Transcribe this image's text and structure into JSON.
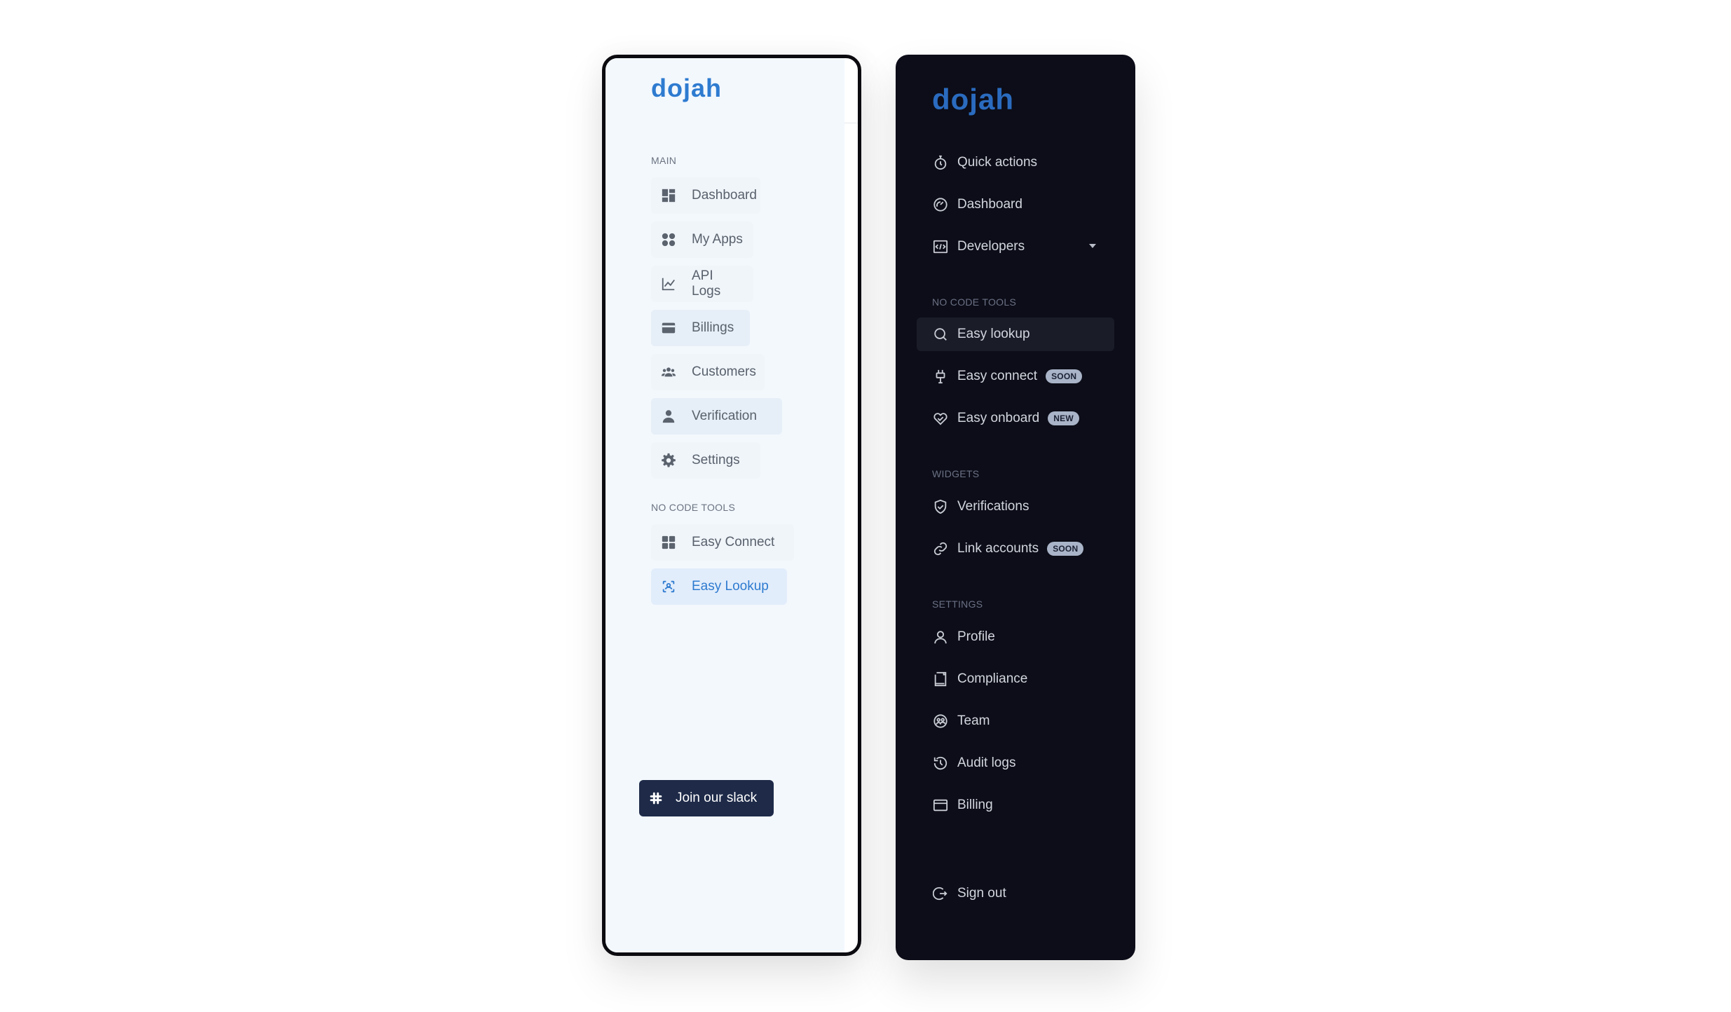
{
  "light": {
    "logo": "dojah",
    "sections": {
      "main": "MAIN",
      "no_code": "NO CODE  TOOLS"
    },
    "items": [
      {
        "label": "Dashboard",
        "icon": "dashboard-icon"
      },
      {
        "label": "My Apps",
        "icon": "apps-icon"
      },
      {
        "label": "API Logs",
        "icon": "chart-icon"
      },
      {
        "label": "Billings",
        "icon": "card-icon"
      },
      {
        "label": "Customers",
        "icon": "users-icon"
      },
      {
        "label": "Verification",
        "icon": "person-icon"
      },
      {
        "label": "Settings",
        "icon": "gear-icon"
      },
      {
        "label": "Easy Connect",
        "icon": "grid-icon"
      },
      {
        "label": "Easy Lookup",
        "icon": "lookup-icon"
      }
    ],
    "slack_label": "Join our slack",
    "accent": "#2e7bd0",
    "sidebar_bg": "#f3f8fd"
  },
  "dark": {
    "logo": "dojah",
    "sections": {
      "no_code": "NO CODE TOOLS",
      "widgets": "WIDGETS",
      "settings": "SETTINGS"
    },
    "items": [
      {
        "label": "Quick actions",
        "icon": "stopwatch-icon"
      },
      {
        "label": "Dashboard",
        "icon": "gauge-icon"
      },
      {
        "label": "Developers",
        "icon": "code-icon"
      },
      {
        "label": "Easy lookup",
        "icon": "search-icon"
      },
      {
        "label": "Easy connect",
        "icon": "plug-icon",
        "badge": "SOON"
      },
      {
        "label": "Easy onboard",
        "icon": "handshake-icon",
        "badge": "NEW"
      },
      {
        "label": "Verifications",
        "icon": "shield-check-icon"
      },
      {
        "label": "Link accounts",
        "icon": "link-icon",
        "badge": "SOON"
      },
      {
        "label": "Profile",
        "icon": "user-icon"
      },
      {
        "label": "Compliance",
        "icon": "document-icon"
      },
      {
        "label": "Team",
        "icon": "team-icon"
      },
      {
        "label": "Audit logs",
        "icon": "history-icon"
      },
      {
        "label": "Billing",
        "icon": "card-icon"
      },
      {
        "label": "Sign out",
        "icon": "sign-out-icon"
      }
    ],
    "bg": "#0c0d18",
    "accent": "#2a6bbf"
  }
}
